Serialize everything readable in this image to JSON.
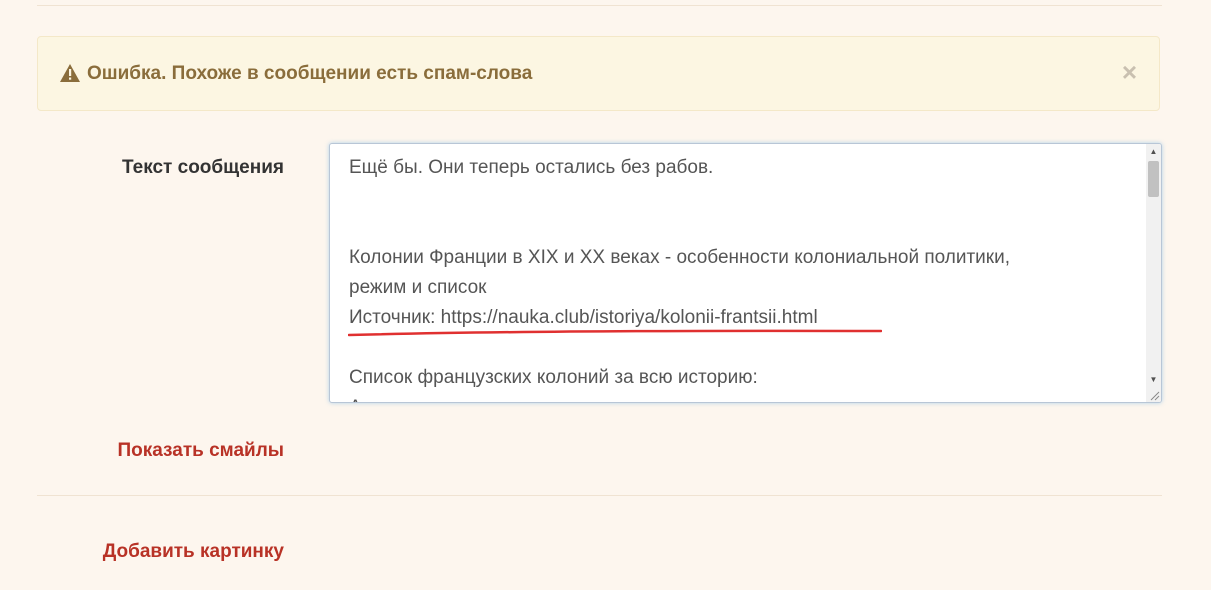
{
  "alert": {
    "icon": "warning-triangle-icon",
    "text": "Ошибка. Похоже в сообщении есть спам-слова",
    "close_glyph": "×"
  },
  "form": {
    "message_label": "Текст сообщения",
    "message_lines": [
      "Ещё бы. Они теперь остались без рабов.",
      "",
      "",
      "Колонии Франции в XIX и XX веках - особенности колониальной политики,",
      "режим и список",
      "Источник: https://nauka.club/istoriya/kolonii-frantsii.html",
      "",
      "Список французских колоний за всю историю:",
      "А"
    ],
    "underline_color": "#e03030",
    "show_smiles_link": "Показать смайлы",
    "add_image_link": "Добавить картинку"
  },
  "colors": {
    "page_bg": "#fdf6ee",
    "alert_bg": "#fcf6e2",
    "alert_text": "#8a6d3b",
    "link": "#b83226"
  }
}
